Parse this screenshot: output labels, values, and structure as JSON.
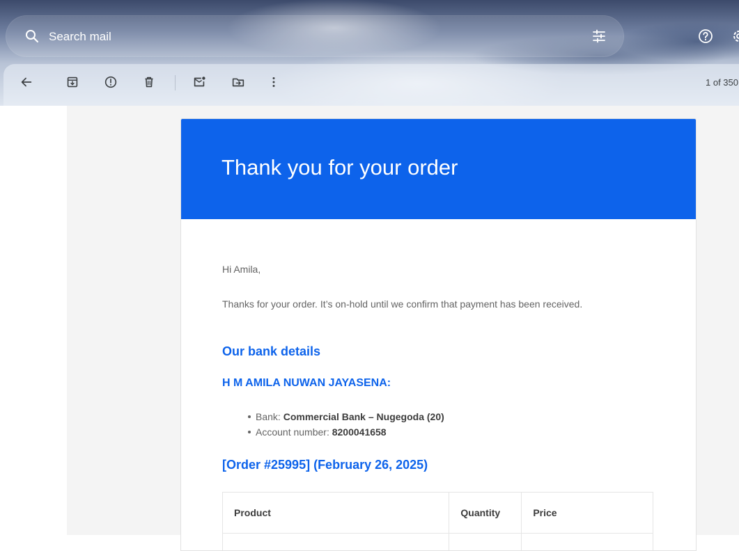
{
  "search": {
    "placeholder": "Search mail"
  },
  "toolbar": {
    "pager": "1 of 350"
  },
  "email": {
    "header_title": "Thank you for your order",
    "greeting": "Hi Amila,",
    "intro": "Thanks for your order. It’s on-hold until we confirm that payment has been received.",
    "bank_heading": "Our bank details",
    "account_name": "H M AMILA NUWAN JAYASENA:",
    "bank_details": [
      {
        "label": "Bank:",
        "value": "Commercial Bank – Nugegoda (20)"
      },
      {
        "label": "Account number:",
        "value": "8200041658"
      }
    ],
    "order_heading": "[Order #25995] (February 26, 2025)",
    "table": {
      "headers": [
        "Product",
        "Quantity",
        "Price"
      ]
    }
  },
  "colors": {
    "brand_blue": "#0d63eb",
    "body_text": "#636363",
    "content_bg": "#f4f4f4"
  },
  "icons": {
    "search": "search-icon",
    "tune": "tune-icon",
    "help": "help-icon",
    "settings": "settings-icon",
    "back": "back-arrow-icon",
    "archive": "archive-icon",
    "spam": "report-spam-icon",
    "delete": "trash-icon",
    "unread": "mark-unread-icon",
    "move": "move-to-icon",
    "more": "more-vert-icon"
  }
}
